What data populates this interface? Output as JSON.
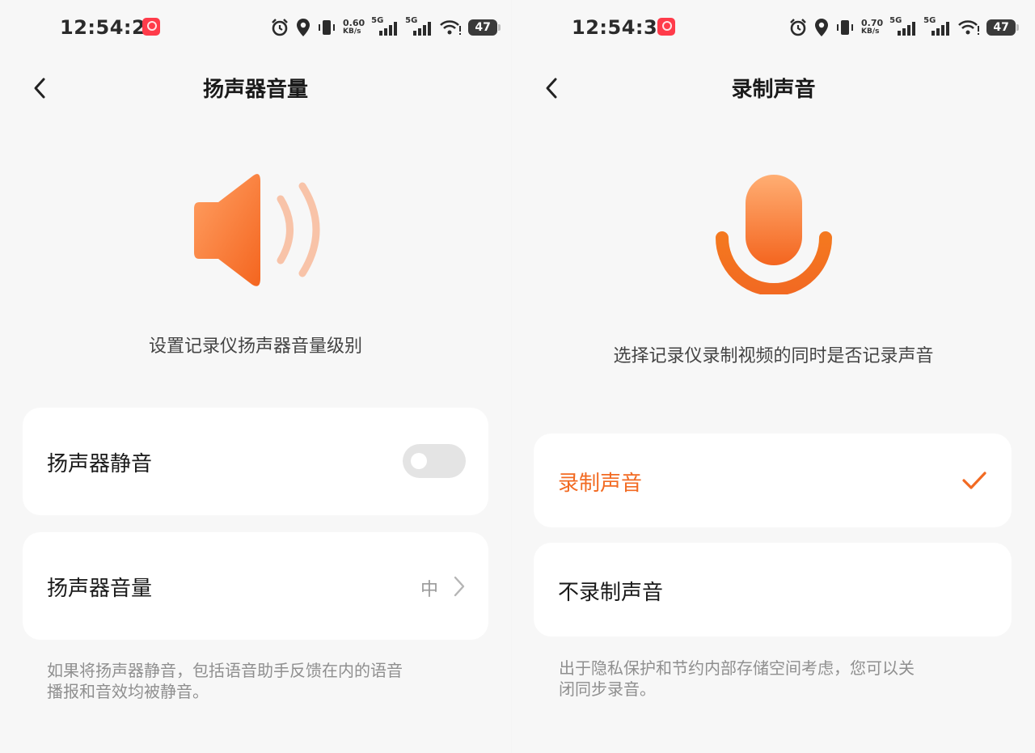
{
  "colors": {
    "accent": "#f26a22",
    "accent_light": "#ffae73",
    "background": "#f7f7f7",
    "card": "#ffffff",
    "toggle_off": "#e4e4e4"
  },
  "left": {
    "status_bar": {
      "time": "12:54:27",
      "speed_value": "0.60",
      "speed_unit": "KB/s",
      "net1": "5G",
      "net2": "5G",
      "battery": "47"
    },
    "header": {
      "title": "扬声器音量",
      "back_icon": "back-arrow-icon"
    },
    "hero_icon": "speaker-icon",
    "description": "设置记录仪扬声器音量级别",
    "mute_row": {
      "label": "扬声器静音",
      "toggle_on": false
    },
    "volume_row": {
      "label": "扬声器音量",
      "value": "中"
    },
    "footnote": {
      "line1": "如果将扬声器静音，包括语音助手反馈在内的语音",
      "line2": "播报和音效均被静音。"
    }
  },
  "right": {
    "status_bar": {
      "time": "12:54:32",
      "speed_value": "0.70",
      "speed_unit": "KB/s",
      "net1": "5G",
      "net2": "5G",
      "battery": "47"
    },
    "header": {
      "title": "录制声音",
      "back_icon": "back-arrow-icon"
    },
    "hero_icon": "microphone-icon",
    "description": "选择记录仪录制视频的同时是否记录声音",
    "options": [
      {
        "label": "录制声音",
        "selected": true
      },
      {
        "label": "不录制声音",
        "selected": false
      }
    ],
    "footnote": {
      "line1": "出于隐私保护和节约内部存储空间考虑，您可以关",
      "line2": "闭同步录音。"
    }
  }
}
